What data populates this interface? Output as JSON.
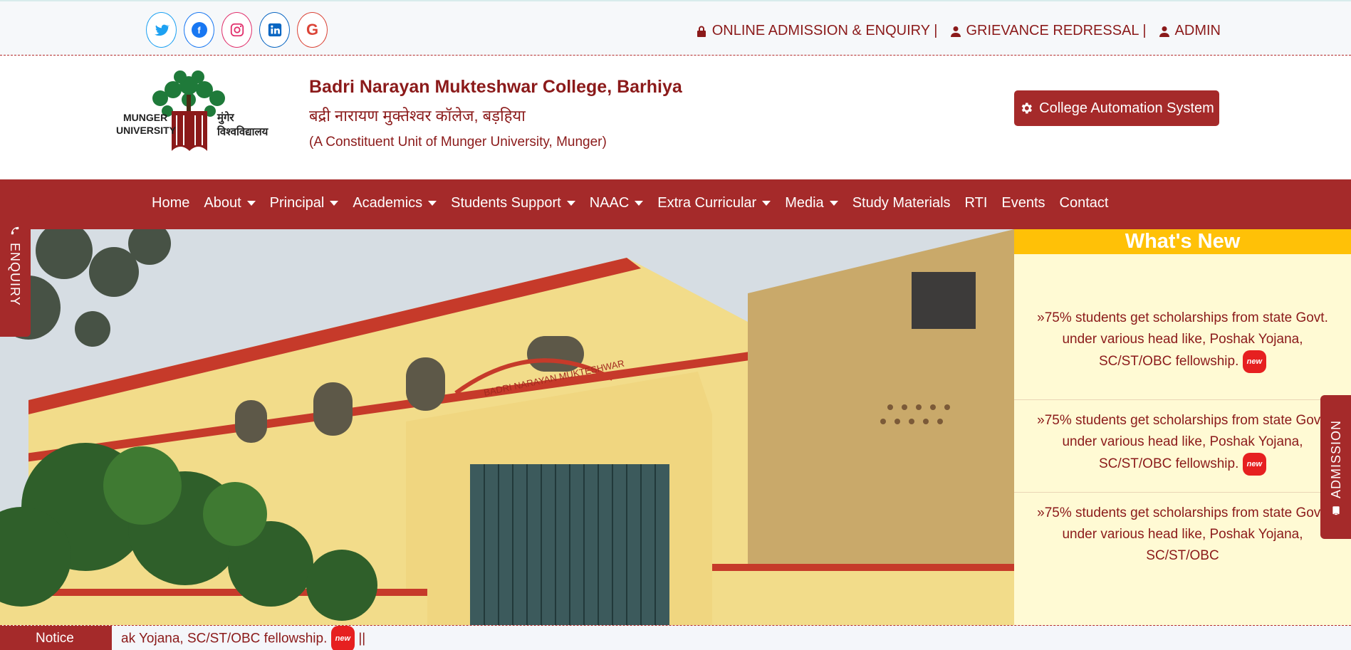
{
  "topbar": {
    "social": [
      {
        "name": "twitter-icon"
      },
      {
        "name": "facebook-icon"
      },
      {
        "name": "instagram-icon"
      },
      {
        "name": "linkedin-icon"
      },
      {
        "name": "google-icon"
      }
    ],
    "links": {
      "admission": "ONLINE ADMISSION & ENQUIRY |",
      "grievance": "GRIEVANCE REDRESSAL |",
      "admin": "ADMIN"
    }
  },
  "header": {
    "title_en": "Badri Narayan Mukteshwar College, Barhiya",
    "title_hi": "बद्री नारायण मुक्तेश्वर कॉलेज, बड़हिया",
    "subtitle": "(A Constituent Unit of Munger University, Munger)",
    "cas_button": "College Automation System",
    "logo_text_en": "MUNGER\nUNIVERSITY",
    "logo_text_hi": "मुंगेर\nविश्वविद्यालय"
  },
  "nav": {
    "home": "Home",
    "about": "About",
    "principal": "Principal",
    "academics": "Academics",
    "students_support": "Students Support",
    "naac": "NAAC",
    "extra_curricular": "Extra Curricular",
    "media": "Media",
    "study_materials": "Study Materials",
    "rti": "RTI",
    "events": "Events",
    "contact": "Contact"
  },
  "side_tabs": {
    "enquiry": "ENQUIRY",
    "admission": "ADMISSION"
  },
  "whats_new": {
    "heading": "What's New",
    "items": [
      "75% students get scholarships from state Govt. under various head like, Poshak Yojana, SC/ST/OBC fellowship.",
      "75% students get scholarships from state Govt. under various head like, Poshak Yojana, SC/ST/OBC fellowship.",
      "75% students get scholarships from state Govt. under various head like, Poshak Yojana, SC/ST/OBC"
    ],
    "badge": "new"
  },
  "notice": {
    "label": "Notice",
    "text": "ak Yojana, SC/ST/OBC fellowship.",
    "separator": "||",
    "badge": "new"
  },
  "hero": {
    "building_sign": "BADRI NARAYAN MUKTESHWAR"
  },
  "colors": {
    "brand": "#a52a2a",
    "accent": "#ffc107",
    "panel": "#fffad4"
  }
}
